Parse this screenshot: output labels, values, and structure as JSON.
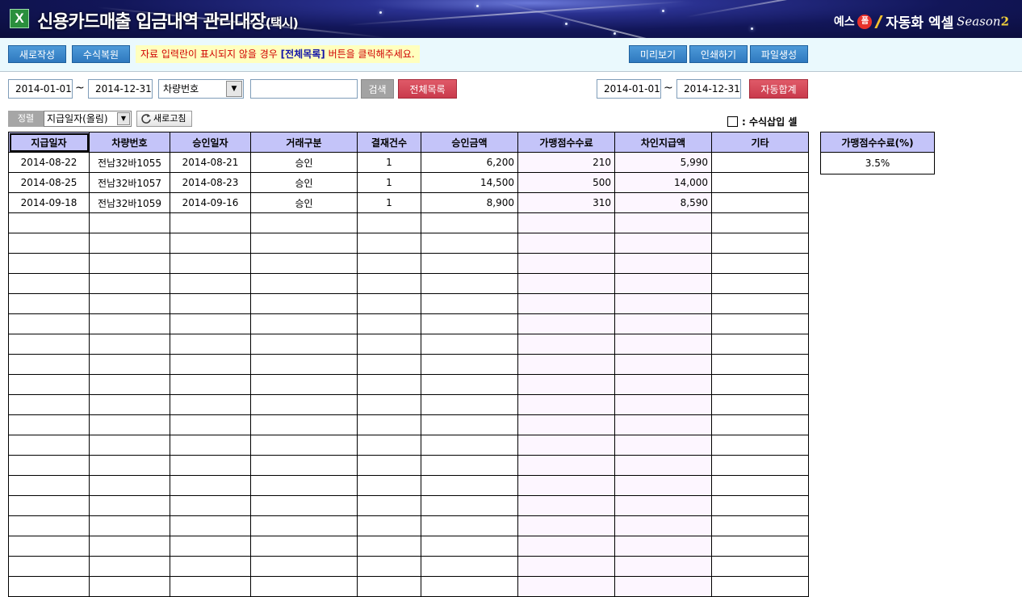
{
  "header": {
    "title": "신용카드매출 입금내역 관리대장",
    "subtitle": "(택시)",
    "brand_prefix": "예스",
    "brand_logo": "폼",
    "brand_name": "자동화 엑셀",
    "brand_season": "Season",
    "brand_season_num": "2",
    "icon": "excel-icon"
  },
  "toolbar": {
    "new_label": "새로작성",
    "restore_label": "수식복원",
    "notice_pre": "자료 입력란이 표시되지  않을 경우 ",
    "notice_highlight": "[전체목록]",
    "notice_post": " 버튼을 클릭해주세요.",
    "preview_label": "미리보기",
    "print_label": "인쇄하기",
    "file_label": "파일생성"
  },
  "search": {
    "start_date": "2014-01-01",
    "end_date": "2014-12-31",
    "tilde": "~",
    "field_selected": "차량번호",
    "keyword": "",
    "search_label": "검색",
    "list_all_label": "전체목록",
    "sum_start_date": "2014-01-01",
    "sum_end_date": "2014-12-31",
    "auto_sum_label": "자동합계"
  },
  "sort": {
    "label": "정렬",
    "selected": "지급일자(올림)",
    "refresh_label": "새로고침",
    "legend_text": ": 수식삽입 셀"
  },
  "table": {
    "headers": [
      "지급일자",
      "차량번호",
      "승인일자",
      "거래구분",
      "결재건수",
      "승인금액",
      "가맹점수수료",
      "차인지급액",
      "기타"
    ],
    "rows": [
      [
        "2014-08-22",
        "전남32바1055",
        "2014-08-21",
        "승인",
        "1",
        "6,200",
        "210",
        "5,990",
        ""
      ],
      [
        "2014-08-25",
        "전남32바1057",
        "2014-08-23",
        "승인",
        "1",
        "14,500",
        "500",
        "14,000",
        ""
      ],
      [
        "2014-09-18",
        "전남32바1059",
        "2014-09-16",
        "승인",
        "1",
        "8,900",
        "310",
        "8,590",
        ""
      ]
    ],
    "empty_rows": 19
  },
  "fee_table": {
    "header": "가맹점수수료(%)",
    "value": "3.5%"
  },
  "colors": {
    "header_bg": "#c4c4f9",
    "formula_cell_bg": "#fdf6ff",
    "toolbar_bg": "#eaf9fd",
    "button_blue": "#3a86cc",
    "button_red": "#d54b5b",
    "notice_bg": "#ffffbe",
    "notice_text": "#d00000"
  }
}
